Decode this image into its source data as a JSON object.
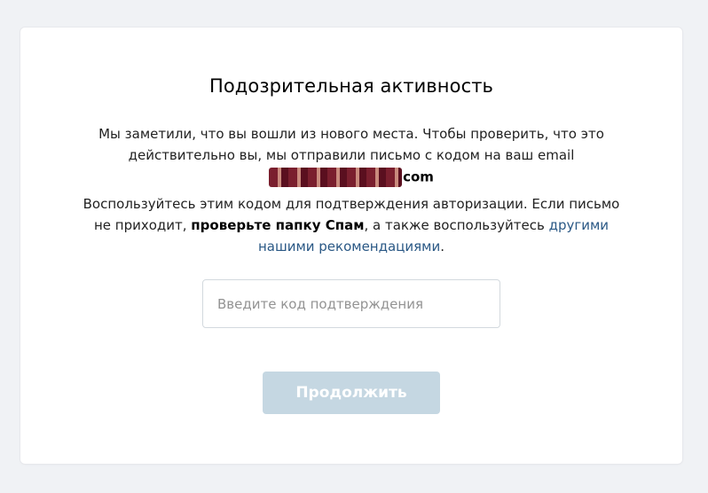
{
  "card": {
    "title": "Подозрительная активность",
    "message_line1": "Мы заметили, что вы вошли из нового места. Чтобы проверить, что это",
    "message_line2": "действительно вы, мы отправили письмо с кодом на ваш email",
    "email_visible_tail": "com",
    "instructions_prefix": "Воспользуйтесь этим кодом для подтверждения авторизации. Если письмо не приходит, ",
    "instructions_bold": "проверьте папку Спам",
    "instructions_middle": ", а также воспользуйтесь ",
    "instructions_link": "другими нашими рекомендациями",
    "instructions_suffix": ".",
    "code_input": {
      "placeholder": "Введите код подтверждения",
      "value": ""
    },
    "continue_button": "Продолжить"
  },
  "colors": {
    "background": "#f0f2f5",
    "link": "#2a5885",
    "button_disabled": "#c5d7e2"
  }
}
